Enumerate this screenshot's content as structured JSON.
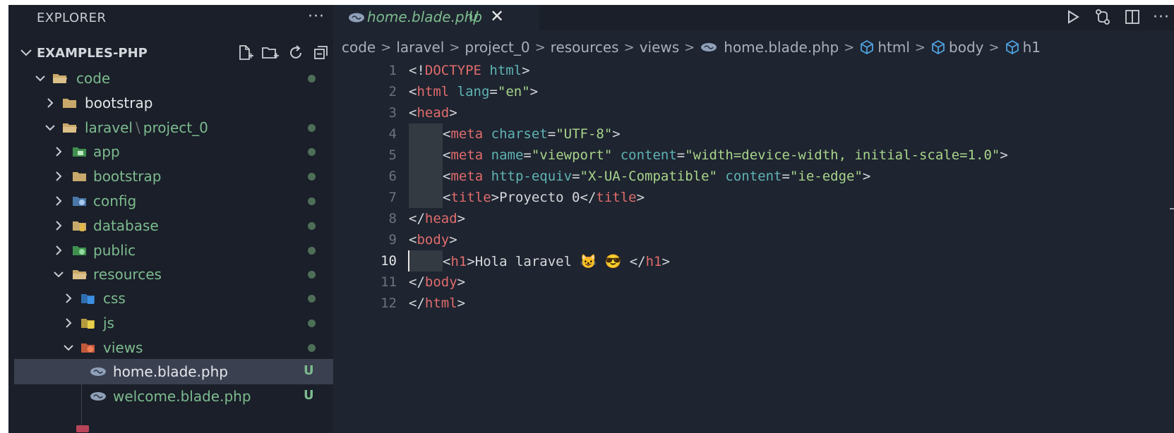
{
  "explorer": {
    "title": "EXPLORER",
    "more": "···",
    "project": "EXAMPLES-PHP",
    "tree": [
      {
        "label": "code",
        "badge": ""
      },
      {
        "label": "bootstrap",
        "badge": ""
      },
      {
        "label_a": "laravel",
        "label_sep": "\\",
        "label_b": "project_0",
        "badge": ""
      },
      {
        "label": "app",
        "badge": ""
      },
      {
        "label": "bootstrap",
        "badge": ""
      },
      {
        "label": "config",
        "badge": ""
      },
      {
        "label": "database",
        "badge": ""
      },
      {
        "label": "public",
        "badge": ""
      },
      {
        "label": "resources",
        "badge": ""
      },
      {
        "label": "css",
        "badge": ""
      },
      {
        "label": "js",
        "badge": ""
      },
      {
        "label": "views",
        "badge": ""
      },
      {
        "label": "home.blade.php",
        "badge": "U"
      },
      {
        "label": "welcome.blade.php",
        "badge": "U"
      }
    ]
  },
  "tab": {
    "name": "home.blade.php",
    "status": "U",
    "close": "✕"
  },
  "editor_actions": {
    "more": "···"
  },
  "breadcrumbs": [
    "code",
    "laravel",
    "project_0",
    "resources",
    "views",
    "home.blade.php",
    "html",
    "body",
    "h1"
  ],
  "code": {
    "active_line": 10,
    "lines": [
      {
        "n": "1",
        "a": "<!",
        "b": "DOCTYPE",
        "c": " html",
        "d": ">"
      },
      {
        "n": "2",
        "a": "<",
        "b": "html",
        "c": " lang",
        "d": "=",
        "e": "\"en\"",
        "f": ">"
      },
      {
        "n": "3",
        "a": "<",
        "b": "head",
        "c": ">"
      },
      {
        "n": "4",
        "a": "<",
        "b": "meta",
        "c": " charset",
        "d": "=",
        "e": "\"UTF-8\"",
        "f": ">"
      },
      {
        "n": "5",
        "a": "<",
        "b": "meta",
        "c": " name",
        "d": "=",
        "e": "\"viewport\"",
        "g": " content",
        "h": "=",
        "i": "\"width=device-width, initial-scale=1.0\"",
        "f": ">"
      },
      {
        "n": "6",
        "a": "<",
        "b": "meta",
        "c": " http-equiv",
        "d": "=",
        "e": "\"X-UA-Compatible\"",
        "g": " content",
        "h": "=",
        "i": "\"ie-edge\"",
        "f": ">"
      },
      {
        "n": "7",
        "a": "<",
        "b": "title",
        "c": ">",
        "d": "Proyecto 0",
        "e": "</",
        "f": "title",
        "g": ">"
      },
      {
        "n": "8",
        "a": "</",
        "b": "head",
        "c": ">"
      },
      {
        "n": "9",
        "a": "<",
        "b": "body",
        "c": ">"
      },
      {
        "n": "10",
        "a": "<",
        "b": "h1",
        "c": ">",
        "d": "Hola laravel 😺 😎 ",
        "e": "</",
        "f": "h1",
        "g": ">"
      },
      {
        "n": "11",
        "a": "</",
        "b": "body",
        "c": ">"
      },
      {
        "n": "12",
        "a": "</",
        "b": "html",
        "c": ">"
      }
    ]
  }
}
